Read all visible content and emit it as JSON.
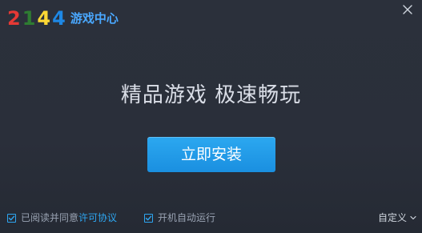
{
  "brand": {
    "digits": [
      "2",
      "1",
      "4",
      "4"
    ],
    "digit_colors": [
      "#e53935",
      "#2e7d32",
      "#fdd835",
      "#1e88e5"
    ],
    "name": "游戏中心",
    "name_color": "#4aa8ff"
  },
  "window": {
    "close_icon": "close-icon"
  },
  "main": {
    "headline": "精品游戏  极速畅玩",
    "install_label": "立即安装"
  },
  "footer": {
    "agree_checkbox_checked": true,
    "agree_prefix": "已阅读并同意",
    "agree_link": "许可协议",
    "autostart_checkbox_checked": true,
    "autostart_label": "开机自动运行",
    "custom_label": "自定义"
  },
  "colors": {
    "accent": "#2ea6f1",
    "background": "#2a2f3a",
    "button_top": "#2ca8f0",
    "button_bottom": "#1a8fe0",
    "muted_text": "#9aa3b3"
  }
}
